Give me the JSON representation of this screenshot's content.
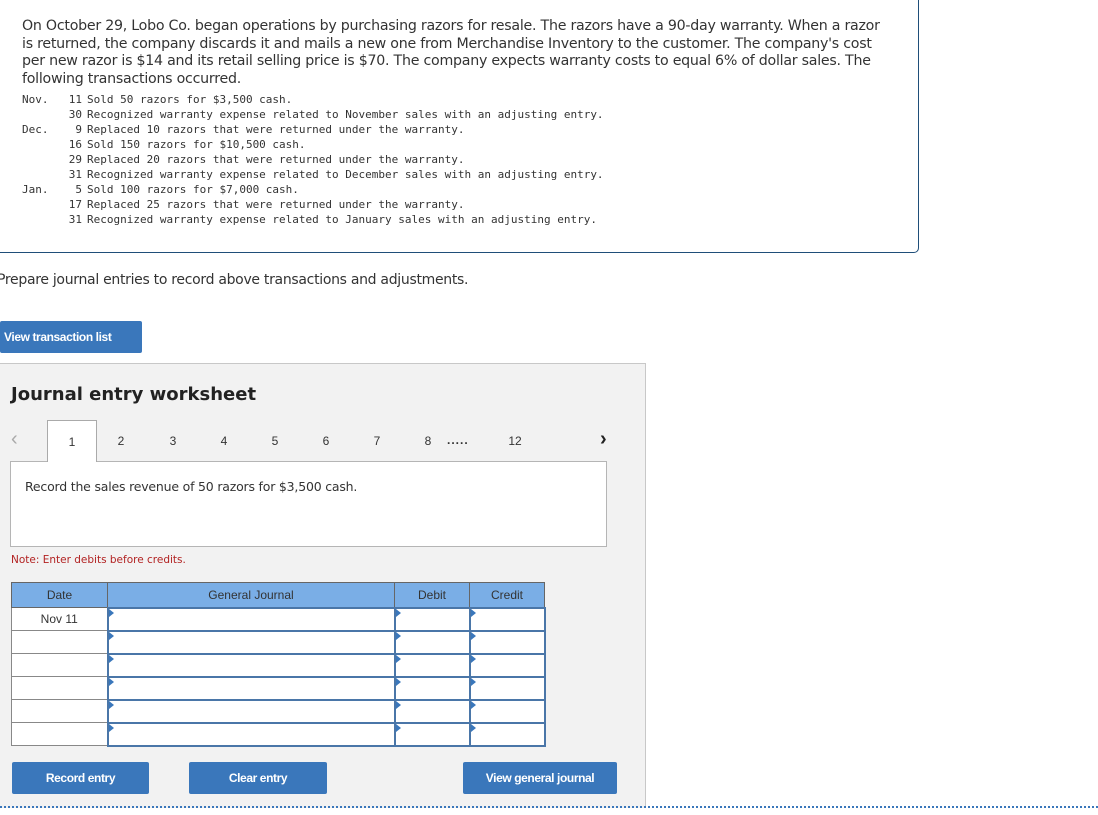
{
  "question": {
    "intro": "On October 29, Lobo Co. began operations by purchasing razors for resale. The razors have a 90-day warranty. When a razor is returned, the company discards it and mails a new one from Merchandise Inventory to the customer. The company's cost per new razor is $14 and its retail selling price is $70. The company expects warranty costs to equal 6%  of dollar sales. The following transactions occurred.",
    "transactions": [
      {
        "month": "Nov.",
        "day": "11",
        "description": "Sold 50 razors for $3,500 cash."
      },
      {
        "month": "",
        "day": "30",
        "description": "Recognized warranty expense related to November sales with an adjusting entry."
      },
      {
        "month": "Dec.",
        "day": "9",
        "description": "Replaced 10 razors that were returned under the warranty."
      },
      {
        "month": "",
        "day": "16",
        "description": "Sold 150 razors for $10,500 cash."
      },
      {
        "month": "",
        "day": "29",
        "description": "Replaced 20 razors that were returned under the warranty."
      },
      {
        "month": "",
        "day": "31",
        "description": "Recognized warranty expense related to December sales with an adjusting entry."
      },
      {
        "month": "Jan.",
        "day": "5",
        "description": "Sold 100 razors for $7,000 cash."
      },
      {
        "month": "",
        "day": "17",
        "description": "Replaced 25 razors that were returned under the warranty."
      },
      {
        "month": "",
        "day": "31",
        "description": "Recognized warranty expense related to January sales with an adjusting entry."
      }
    ]
  },
  "prompt": "Prepare journal entries to record above transactions and adjustments.",
  "buttons": {
    "view_transaction_list": "View transaction list",
    "record_entry": "Record entry",
    "clear_entry": "Clear entry",
    "view_general_journal": "View general journal"
  },
  "worksheet": {
    "title": "Journal entry worksheet",
    "pager": {
      "prev_icon": "‹",
      "next_icon": "›",
      "tabs": [
        "1",
        "2",
        "3",
        "4",
        "5",
        "6",
        "7",
        "8"
      ],
      "ellipsis": ".....",
      "last_tab": "12",
      "active_tab": "1"
    },
    "description": "Record the sales revenue of 50 razors for $3,500 cash.",
    "note": "Note: Enter debits before credits.",
    "table": {
      "headers": {
        "date": "Date",
        "general_journal": "General Journal",
        "debit": "Debit",
        "credit": "Credit"
      },
      "rows": [
        {
          "date": "Nov 11",
          "account": "",
          "debit": "",
          "credit": ""
        },
        {
          "date": "",
          "account": "",
          "debit": "",
          "credit": ""
        },
        {
          "date": "",
          "account": "",
          "debit": "",
          "credit": ""
        },
        {
          "date": "",
          "account": "",
          "debit": "",
          "credit": ""
        },
        {
          "date": "",
          "account": "",
          "debit": "",
          "credit": ""
        },
        {
          "date": "",
          "account": "",
          "debit": "",
          "credit": ""
        }
      ]
    }
  },
  "colors": {
    "button_blue": "#3a77bb",
    "header_blue": "#7aaee6",
    "note_red": "#b22222",
    "panel_gray": "#f2f2f2"
  }
}
